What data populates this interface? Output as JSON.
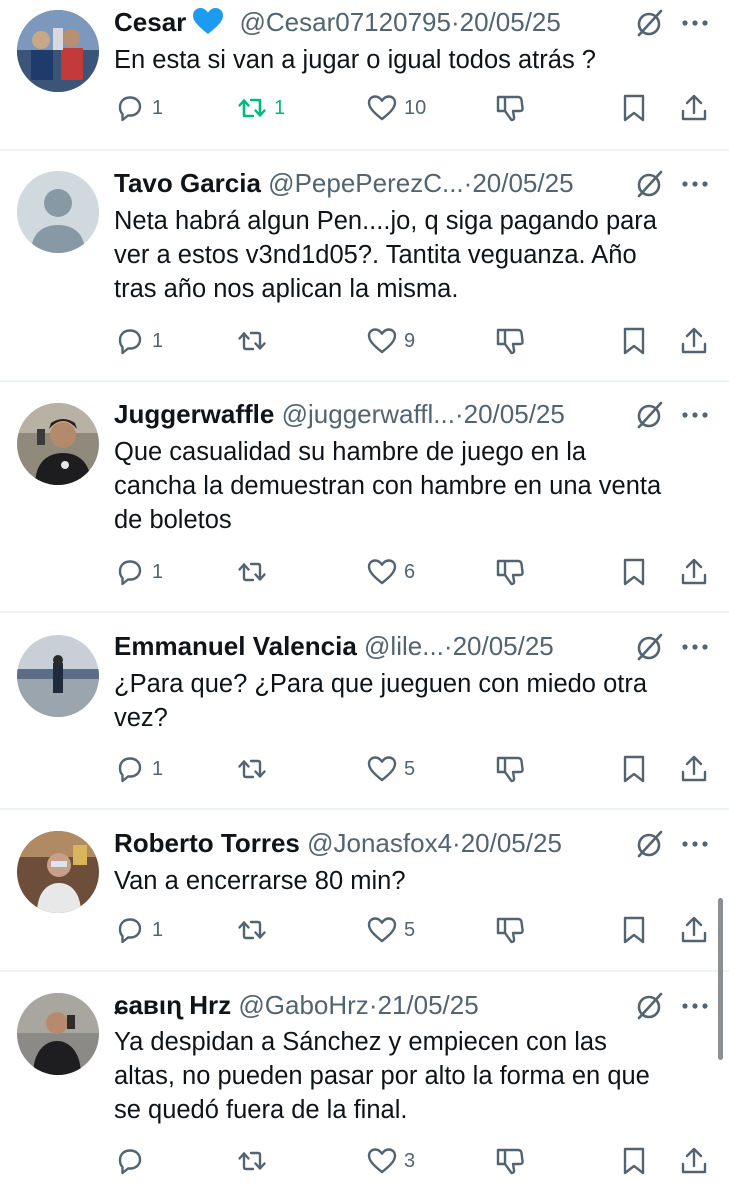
{
  "tweets": [
    {
      "name": "Cesar",
      "verified_heart": true,
      "handle": "@Cesar07120795",
      "date": "20/05/25",
      "text_lines": [
        "En esta si van a jugar o igual todos atrás ?"
      ],
      "replies": "1",
      "retweets": "1",
      "retweeted": true,
      "likes": "10"
    },
    {
      "name": "Tavo Garcia",
      "handle": "@PepePerezC...",
      "date": "20/05/25",
      "text_lines": [
        "Neta habrá algun Pen....jo, q siga pagando para",
        "ver a estos v3nd1d05?. Tantita veguanza. Año",
        "tras año nos aplican la misma."
      ],
      "replies": "1",
      "retweets": "",
      "likes": "9"
    },
    {
      "name": "Juggerwaffle",
      "handle": "@juggerwaffl...",
      "date": "20/05/25",
      "text_lines": [
        "Que casualidad su hambre de juego en la",
        "cancha la demuestran con hambre en una venta",
        "de boletos"
      ],
      "replies": "1",
      "retweets": "",
      "likes": "6"
    },
    {
      "name": "Emmanuel Valencia",
      "handle": "@lile...",
      "date": "20/05/25",
      "text_lines": [
        "¿Para que? ¿Para que jueguen con miedo otra",
        "vez?"
      ],
      "replies": "1",
      "retweets": "",
      "likes": "5"
    },
    {
      "name": "Roberto Torres",
      "handle": "@Jonasfox4",
      "date": "20/05/25",
      "text_lines": [
        "Van a encerrarse 80 min?"
      ],
      "replies": "1",
      "retweets": "",
      "likes": "5"
    },
    {
      "name": "ɕaвιɳ Hrz",
      "handle": "@GaboHrz",
      "date": "21/05/25",
      "text_lines": [
        "Ya despidan a Sánchez y empiecen con las",
        "altas, no pueden pasar por alto la forma en que",
        "se quedó fuera de la final."
      ],
      "replies": "",
      "retweets": "",
      "likes": "3"
    }
  ],
  "separator": "·",
  "icons": {
    "reply": "reply-icon",
    "retweet": "retweet-icon",
    "like": "heart-icon",
    "dislike": "downvote-icon",
    "bookmark": "bookmark-icon",
    "share": "share-icon",
    "grok": "grok-icon",
    "more": "more-icon"
  },
  "colors": {
    "text": "#0f1419",
    "secondary": "#536471",
    "retweet_active": "#00ba7c",
    "verified_heart": "#1d9bf0"
  }
}
